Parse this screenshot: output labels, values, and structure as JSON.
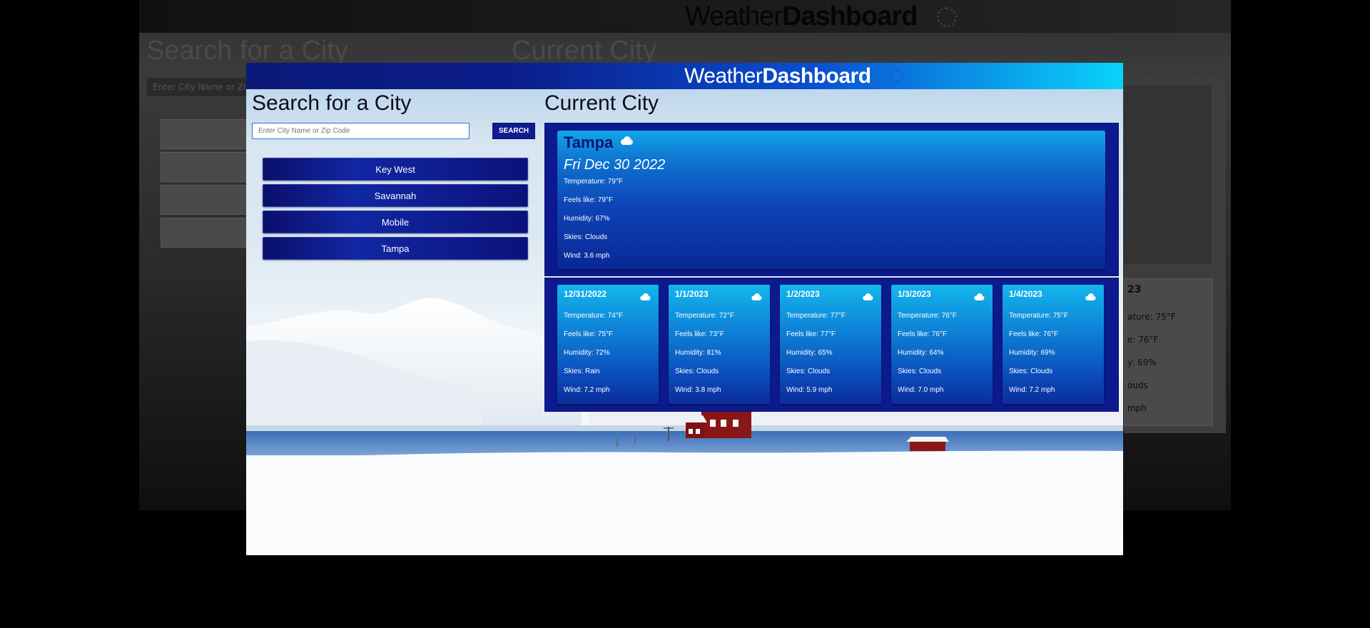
{
  "header": {
    "title_light": "Weather",
    "title_bold": "Dashboard",
    "icon": "sun-icon"
  },
  "search": {
    "heading": "Search for a City",
    "placeholder": "Enter City Name or Zip Code",
    "button_label": "SEARCH"
  },
  "history": [
    {
      "label": "Key West"
    },
    {
      "label": "Savannah"
    },
    {
      "label": "Mobile"
    },
    {
      "label": "Tampa"
    }
  ],
  "current": {
    "heading": "Current City",
    "city": "Tampa",
    "icon": "cloud-icon",
    "date": "Fri Dec 30 2022",
    "temperature": "Temperature: 79°F",
    "feels_like": "Feels like: 79°F",
    "humidity": "Humidity: 67%",
    "skies": "Skies: Clouds",
    "wind": "Wind: 3.6 mph"
  },
  "forecast": [
    {
      "date": "12/31/2022",
      "icon": "cloud-icon",
      "temperature": "Temperature: 74°F",
      "feels_like": "Feels like: 75°F",
      "humidity": "Humidity: 72%",
      "skies": "Skies: Rain",
      "wind": "Wind: 7.2 mph"
    },
    {
      "date": "1/1/2023",
      "icon": "cloud-icon",
      "temperature": "Temperature: 72°F",
      "feels_like": "Feels like: 73°F",
      "humidity": "Humidity: 81%",
      "skies": "Skies: Clouds",
      "wind": "Wind: 3.8 mph"
    },
    {
      "date": "1/2/2023",
      "icon": "cloud-icon",
      "temperature": "Temperature: 77°F",
      "feels_like": "Feels like: 77°F",
      "humidity": "Humidity: 65%",
      "skies": "Skies: Clouds",
      "wind": "Wind: 5.9 mph"
    },
    {
      "date": "1/3/2023",
      "icon": "cloud-icon",
      "temperature": "Temperature: 76°F",
      "feels_like": "Feels like: 76°F",
      "humidity": "Humidity: 64%",
      "skies": "Skies: Clouds",
      "wind": "Wind: 7.0 mph"
    },
    {
      "date": "1/4/2023",
      "icon": "cloud-icon",
      "temperature": "Temperature: 75°F",
      "feels_like": "Feels like: 76°F",
      "humidity": "Humidity: 69%",
      "skies": "Skies: Clouds",
      "wind": "Wind: 7.2 mph"
    }
  ],
  "background_copy": {
    "title_light": "Weather",
    "title_bold": "Dashboard",
    "search_heading": "Search for a City",
    "current_heading": "Current City",
    "placeholder_partial": "Enter City Name or Zip",
    "card_date_partial": "23",
    "card_lines": [
      "ature: 75°F",
      "e: 76°F",
      "y: 69%",
      "ouds",
      "mph"
    ]
  },
  "colors": {
    "header_start": "#0b1a78",
    "header_end": "#0ad3fb",
    "panel": "#0d1a8f",
    "city_button": "#1127a3"
  }
}
